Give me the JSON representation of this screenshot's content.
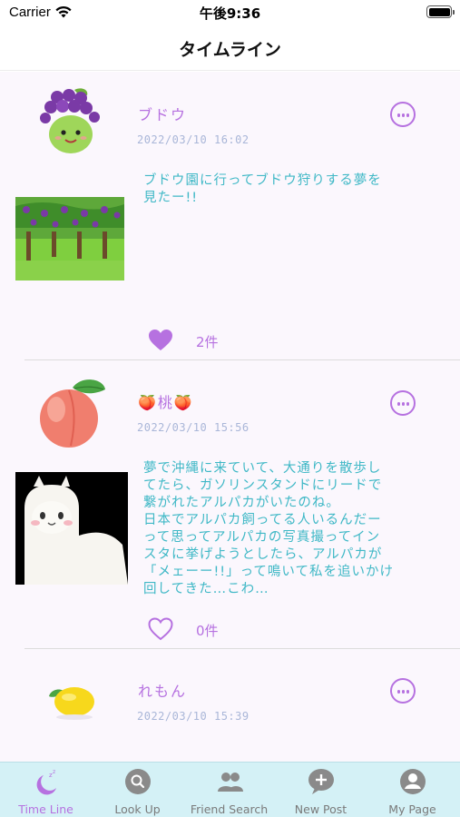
{
  "status_bar": {
    "carrier": "Carrier",
    "time": "午後9:36"
  },
  "nav": {
    "title": "タイムライン"
  },
  "colors": {
    "accent": "#b671e0",
    "text_body": "#3fb8c6",
    "tab_bar_bg": "#d4f1f6",
    "timestamp": "#a9b6d8"
  },
  "posts": [
    {
      "username": "ブドウ",
      "timestamp": "2022/03/10 16:02",
      "avatar": "grape-character-icon",
      "image": "grape-orchard-illustration",
      "text_lines": [
        "ブドウ園に行ってブドウ狩りする夢を",
        "見たー!!"
      ],
      "liked": true,
      "like_count": "2件"
    },
    {
      "username": "🍑桃🍑",
      "timestamp": "2022/03/10 15:56",
      "avatar": "peach-icon",
      "image": "alpaca-illustration",
      "text_lines": [
        "夢で沖縄に来ていて、大通りを散歩し",
        "てたら、ガソリンスタンドにリードで",
        "繋がれたアルパカがいたのね。",
        "日本でアルパカ飼ってる人いるんだー",
        "って思ってアルパカの写真撮ってイン",
        "スタに挙げようとしたら、アルパカが",
        "「メェーー!!」って鳴いて私を追いかけ",
        "回してきた…こわ…"
      ],
      "liked": false,
      "like_count": "0件"
    },
    {
      "username": "れもん",
      "timestamp": "2022/03/10 15:39",
      "avatar": "lemon-icon"
    }
  ],
  "tabs": [
    {
      "label": "Time Line",
      "icon": "sleeping-moon-icon",
      "active": true
    },
    {
      "label": "Look Up",
      "icon": "search-icon",
      "active": false
    },
    {
      "label": "Friend Search",
      "icon": "people-icon",
      "active": false
    },
    {
      "label": "New Post",
      "icon": "add-chat-icon",
      "active": false
    },
    {
      "label": "My Page",
      "icon": "user-icon",
      "active": false
    }
  ]
}
